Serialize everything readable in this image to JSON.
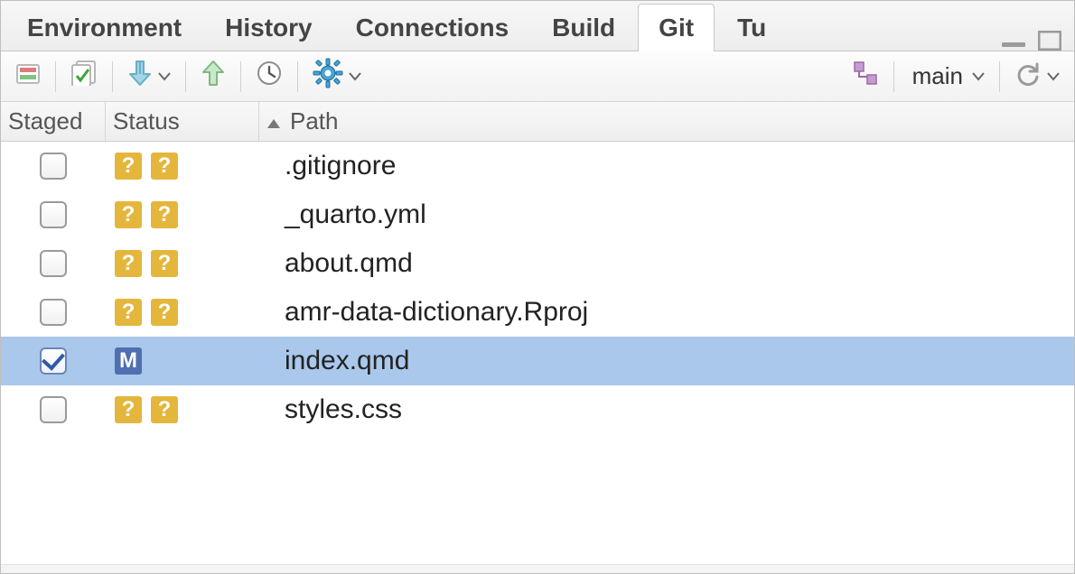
{
  "tabs": {
    "items": [
      {
        "label": "Environment",
        "active": false
      },
      {
        "label": "History",
        "active": false
      },
      {
        "label": "Connections",
        "active": false
      },
      {
        "label": "Build",
        "active": false
      },
      {
        "label": "Git",
        "active": true
      },
      {
        "label": "Tutorial",
        "active": false
      }
    ]
  },
  "toolbar": {
    "branch": "main"
  },
  "columns": {
    "staged": "Staged",
    "status": "Status",
    "path": "Path"
  },
  "files": {
    "items": [
      {
        "staged": false,
        "status": [
          "?",
          "?"
        ],
        "path": ".gitignore",
        "selected": false
      },
      {
        "staged": false,
        "status": [
          "?",
          "?"
        ],
        "path": "_quarto.yml",
        "selected": false
      },
      {
        "staged": false,
        "status": [
          "?",
          "?"
        ],
        "path": "about.qmd",
        "selected": false
      },
      {
        "staged": false,
        "status": [
          "?",
          "?"
        ],
        "path": "amr-data-dictionary.Rproj",
        "selected": false
      },
      {
        "staged": true,
        "status": [
          "M"
        ],
        "path": "index.qmd",
        "selected": true
      },
      {
        "staged": false,
        "status": [
          "?",
          "?"
        ],
        "path": "styles.css",
        "selected": false
      }
    ]
  }
}
